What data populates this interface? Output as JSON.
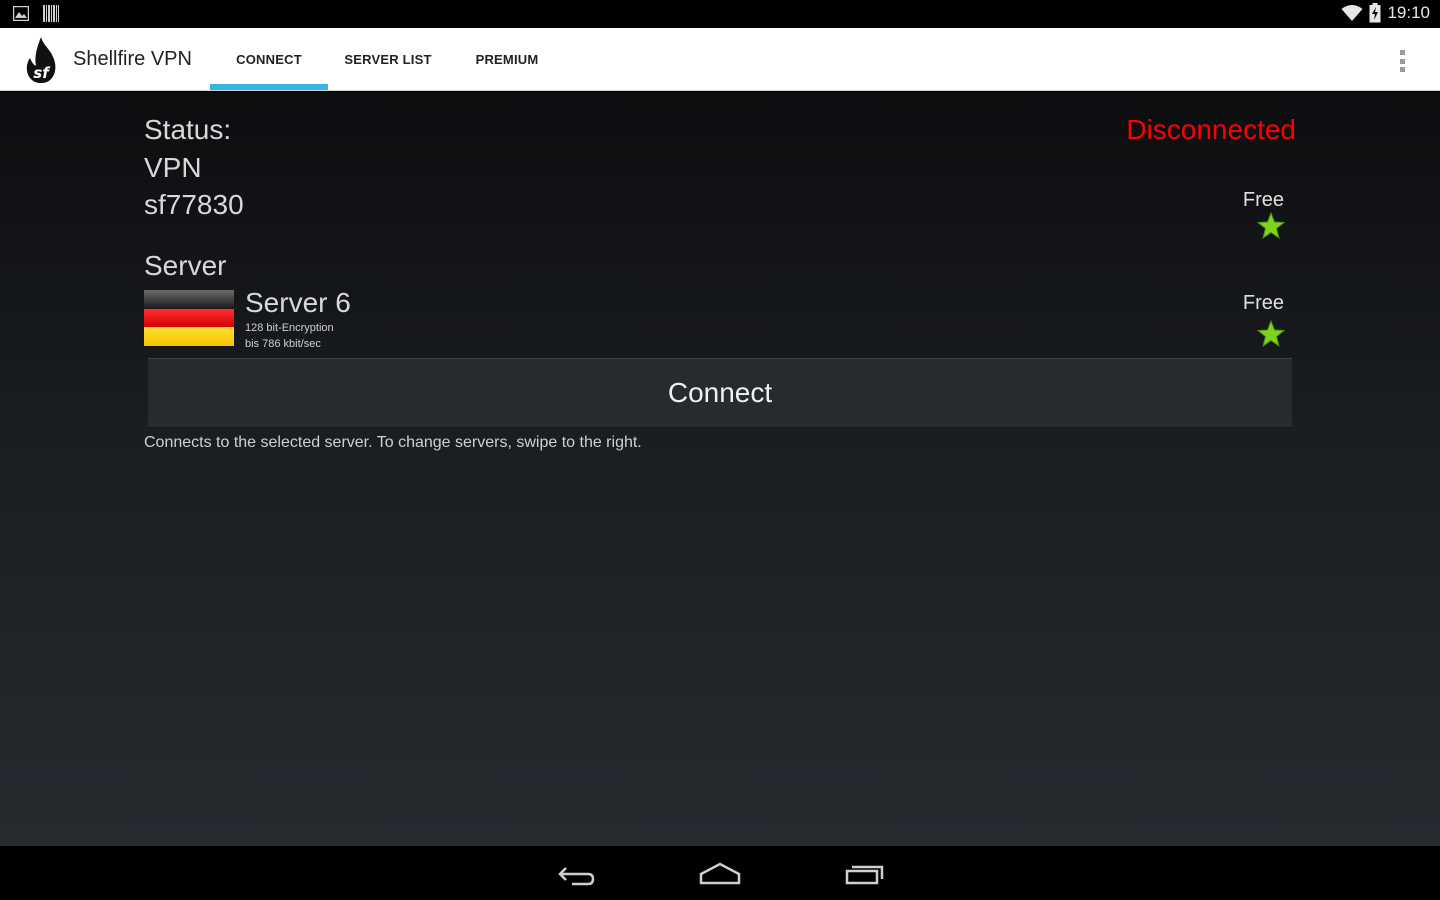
{
  "status_bar": {
    "time": "19:10",
    "left_icons": [
      "image-notification-icon",
      "barcode-notification-icon"
    ],
    "right_icons": [
      "wifi-icon",
      "battery-icon"
    ]
  },
  "app_bar": {
    "title": "Shellfire VPN",
    "logo": "shellfire-flame-logo",
    "tabs": [
      {
        "label": "CONNECT",
        "selected": true
      },
      {
        "label": "SERVER LIST",
        "selected": false
      },
      {
        "label": "PREMIUM",
        "selected": false
      }
    ],
    "accent_color": "#33b5e5"
  },
  "status": {
    "label": "Status:",
    "value": "Disconnected",
    "value_color": "#ff0000"
  },
  "vpn": {
    "label": "VPN",
    "id": "sf77830",
    "account_type": "Free"
  },
  "server": {
    "label": "Server",
    "country_flag": "germany-flag",
    "name": "Server 6",
    "encryption": "128 bit-Encryption",
    "speed": "bis 786 kbit/sec",
    "type": "Free"
  },
  "connect_button": {
    "label": "Connect"
  },
  "hint": "Connects to the selected server. To change servers, swipe to the right.",
  "nav_bar": {
    "buttons": [
      "back-icon",
      "home-icon",
      "recent-apps-icon"
    ]
  }
}
